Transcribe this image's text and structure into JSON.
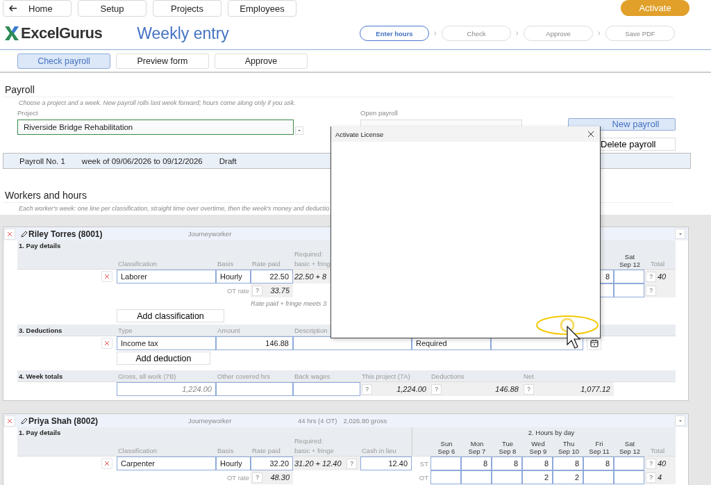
{
  "nav": [
    {
      "label": "Home",
      "kind": "back"
    },
    {
      "label": "Setup",
      "kind": "plain"
    },
    {
      "label": "Projects",
      "kind": "plain"
    },
    {
      "label": "Employees",
      "kind": "plain"
    }
  ],
  "activate_button": "Activate",
  "logo": "ExcelGurus",
  "title": "Weekly entry",
  "steps": [
    {
      "label": "Enter hours",
      "selected": true
    },
    {
      "label": "Check",
      "selected": false
    },
    {
      "label": "Approve",
      "selected": false
    },
    {
      "label": "Save PDF",
      "selected": false
    }
  ],
  "tabs": [
    {
      "label": "Check payroll",
      "selected": true
    },
    {
      "label": "Preview form",
      "selected": false
    },
    {
      "label": "Approve",
      "selected": false
    }
  ],
  "payroll": {
    "heading": "Payroll",
    "hint": "Choose a project and a week. New payroll rolls last week forward; hours come along only if you ask.",
    "project_label": "Project",
    "project_value": "Riverside Bridge Rehabilitation",
    "open_label": "Open payroll",
    "new_button": "New payroll",
    "delete_button": "Delete payroll",
    "summary": [
      "Payroll No. 1",
      "week of 09/06/2026 to 09/12/2026",
      "Draft"
    ]
  },
  "workers_section": {
    "heading": "Workers and hours",
    "hint": "Each worker's week: one line per classification, straight time over overtime, then the week's money and deductio"
  },
  "workers": [
    {
      "name": "Riley Torres (8001)",
      "level": "Journeyworker",
      "pay": {
        "title": "1. Pay details",
        "headers": [
          "Classification",
          "Basis",
          "Rate paid"
        ],
        "req_label": [
          "Required:",
          "basic + fring"
        ],
        "total_label": "Total",
        "days": [
          {
            "st": "8"
          },
          {
            "day": "Sat",
            "date": "Sep 12"
          }
        ],
        "line": {
          "classification": "Laborer",
          "basis": "Hourly",
          "rate": "22.50",
          "required": "22.50 + 8",
          "st_help": "?",
          "st_total": "40",
          "ot_help": "?",
          "ot_rate_label": "OT rate",
          "ot_rate_help": "?",
          "ot_rate": "33.75"
        },
        "note": "Rate paid + fringe meets 3",
        "add_button": "Add classification"
      },
      "deductions": {
        "title": "3. Deductions",
        "headers": [
          "Type",
          "Amount",
          "Description"
        ],
        "rows": [
          {
            "type": "Income tax",
            "amount": "146.88",
            "status": "Required"
          }
        ],
        "add_button": "Add deduction"
      },
      "totals": {
        "title": "4. Week totals",
        "headers": [
          "Gross, all work (7B)",
          "Other covered hrs",
          "Back wages",
          "This project (7A)",
          "Deductions",
          "Net"
        ],
        "gross": "1,224.00",
        "this_project": "1,224.00",
        "deductions": "146.88",
        "net": "1,077.12",
        "helps": [
          "?",
          "?",
          "?"
        ]
      }
    },
    {
      "name": "Priya Shah (8002)",
      "level": "Journeyworker",
      "summary": [
        "44 hrs (4 OT)",
        "2,026.80 gross"
      ],
      "pay": {
        "title": "1. Pay details",
        "headers": [
          "Classification",
          "Basis",
          "Rate paid"
        ],
        "req_label": [
          "Required:",
          "basic + fringe"
        ],
        "cash_label": "Cash in lieu",
        "hours_title": "2. Hours by day",
        "total_label": "Total",
        "days": [
          {
            "day": "Sun",
            "date": "Sep 6"
          },
          {
            "day": "Mon",
            "date": "Sep 7",
            "st": "8"
          },
          {
            "day": "Tue",
            "date": "Sep 8",
            "st": "8"
          },
          {
            "day": "Wed",
            "date": "Sep 9",
            "st": "8",
            "ot": "2"
          },
          {
            "day": "Thu",
            "date": "Sep 10",
            "st": "8",
            "ot": "2"
          },
          {
            "day": "Fri",
            "date": "Sep 11",
            "st": "8"
          },
          {
            "day": "Sat",
            "date": "Sep 12"
          }
        ],
        "line": {
          "classification": "Carpenter",
          "basis": "Hourly",
          "rate": "32.20",
          "required": "31.20 + 12.40",
          "req_help": "?",
          "cash": "12.40",
          "st_label": "ST",
          "ot_label": "OT",
          "st_help": "?",
          "st_total": "40",
          "ot_help": "?",
          "ot_total": "4",
          "ot_rate_label": "OT rate",
          "ot_rate_help": "?",
          "ot_rate": "48.30"
        }
      }
    }
  ],
  "dialog": {
    "title": "Activate License"
  }
}
